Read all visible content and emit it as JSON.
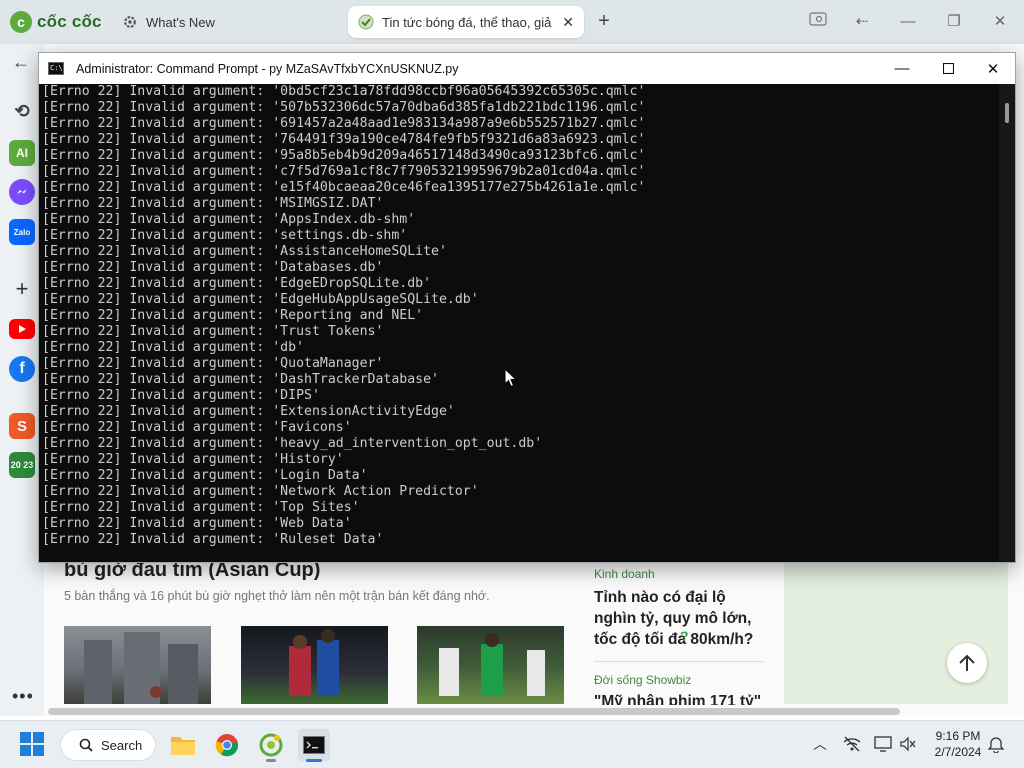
{
  "browser": {
    "brand": "cốc cốc",
    "tabs": [
      {
        "label": "What's New"
      },
      {
        "label": "Tin tức bóng đá, thể thao, giả"
      }
    ]
  },
  "page": {
    "headline": "bù giờ đau tim (Asian Cup)",
    "lead": "5 bàn thắng và 16 phút bù giờ nghẹt thở làm nên một trận bán kết đáng nhớ.",
    "side_news": [
      {
        "category": "Kinh doanh",
        "title": "Tỉnh nào có đại lộ nghìn tỷ, quy mô lớn, tốc độ tối đa 80km/h?"
      },
      {
        "category": "Đời sống Showbiz",
        "title": "\"Mỹ nhân phim 171 tỷ\""
      }
    ]
  },
  "cmd": {
    "title": "Administrator: Command Prompt - py  MZaSAvTfxbYCXnUSKNUZ.py",
    "lines": [
      "[Errno 22] Invalid argument: '0bd5cf23c1a78fdd98ccbf96a05645392c65305c.qmlc'",
      "[Errno 22] Invalid argument: '507b532306dc57a70dba6d385fa1db221bdc1196.qmlc'",
      "[Errno 22] Invalid argument: '691457a2a48aad1e983134a987a9e6b552571b27.qmlc'",
      "[Errno 22] Invalid argument: '764491f39a190ce4784fe9fb5f9321d6a83a6923.qmlc'",
      "[Errno 22] Invalid argument: '95a8b5eb4b9d209a46517148d3490ca93123bfc6.qmlc'",
      "[Errno 22] Invalid argument: 'c7f5d769a1cf8c7f79053219959679b2a01cd04a.qmlc'",
      "[Errno 22] Invalid argument: 'e15f40bcaeaa20ce46fea1395177e275b4261a1e.qmlc'",
      "[Errno 22] Invalid argument: 'MSIMGSIZ.DAT'",
      "[Errno 22] Invalid argument: 'AppsIndex.db-shm'",
      "[Errno 22] Invalid argument: 'settings.db-shm'",
      "[Errno 22] Invalid argument: 'AssistanceHomeSQLite'",
      "[Errno 22] Invalid argument: 'Databases.db'",
      "[Errno 22] Invalid argument: 'EdgeEDropSQLite.db'",
      "[Errno 22] Invalid argument: 'EdgeHubAppUsageSQLite.db'",
      "[Errno 22] Invalid argument: 'Reporting and NEL'",
      "[Errno 22] Invalid argument: 'Trust Tokens'",
      "[Errno 22] Invalid argument: 'db'",
      "[Errno 22] Invalid argument: 'QuotaManager'",
      "[Errno 22] Invalid argument: 'DashTrackerDatabase'",
      "[Errno 22] Invalid argument: 'DIPS'",
      "[Errno 22] Invalid argument: 'ExtensionActivityEdge'",
      "[Errno 22] Invalid argument: 'Favicons'",
      "[Errno 22] Invalid argument: 'heavy_ad_intervention_opt_out.db'",
      "[Errno 22] Invalid argument: 'History'",
      "[Errno 22] Invalid argument: 'Login Data'",
      "[Errno 22] Invalid argument: 'Network Action Predictor'",
      "[Errno 22] Invalid argument: 'Top Sites'",
      "[Errno 22] Invalid argument: 'Web Data'",
      "[Errno 22] Invalid argument: 'Ruleset Data'"
    ]
  },
  "taskbar": {
    "search_label": "Search",
    "time": "9:16 PM",
    "date": "2/7/2024"
  },
  "icons": {
    "sidebar": [
      "history-icon",
      "ai-icon",
      "messenger-icon",
      "zalo-icon",
      "add-icon",
      "youtube-icon",
      "facebook-icon",
      "shopee-icon",
      "calendar-2023-icon",
      "more-icon"
    ],
    "sidebar_text": {
      "ai": "AI",
      "zalo": "Zalo",
      "calendar": "20 23"
    }
  },
  "colors": {
    "console_bg": "#0c0c0c",
    "console_text": "#cccccc",
    "brand_green": "#5cab3c"
  }
}
